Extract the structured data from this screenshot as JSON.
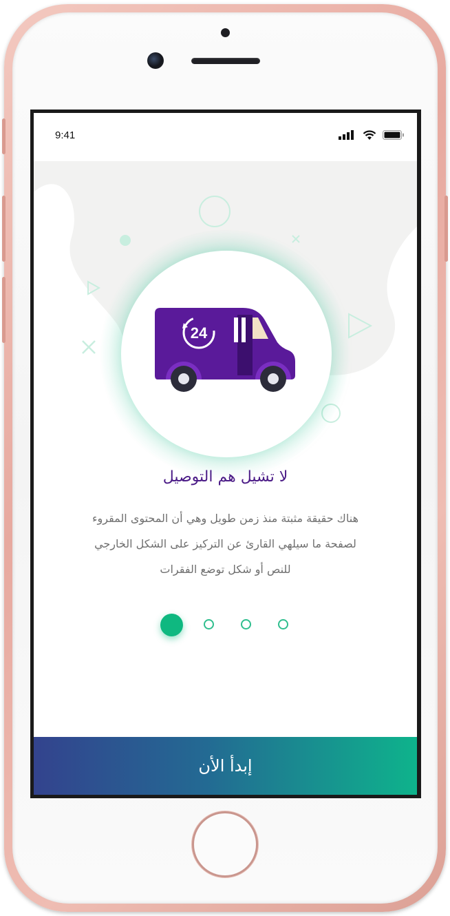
{
  "status_bar": {
    "time": "9:41"
  },
  "onboarding": {
    "title": "لا تشيل هم التوصيل",
    "description_lines": [
      "هناك حقيقة مثبتة منذ زمن طويل وهي أن المحتوى المقروء",
      "لصفحة ما سيلهي القارئ عن التركيز على الشكل الخارجي",
      "للنص أو شكل توضع الفقرات"
    ],
    "page_indicator": {
      "total": 4,
      "current": 1
    },
    "truck_badge": "24",
    "start_button_label": "إبدأ الأن"
  },
  "colors": {
    "accent_green": "#0fb880",
    "title_purple": "#4a1a86",
    "truck_purple": "#5a1a9a",
    "button_gradient_start": "#33438e",
    "button_gradient_end": "#0eb38c"
  },
  "icons": [
    "signal-icon",
    "wifi-icon",
    "battery-icon",
    "delivery-truck-icon"
  ]
}
